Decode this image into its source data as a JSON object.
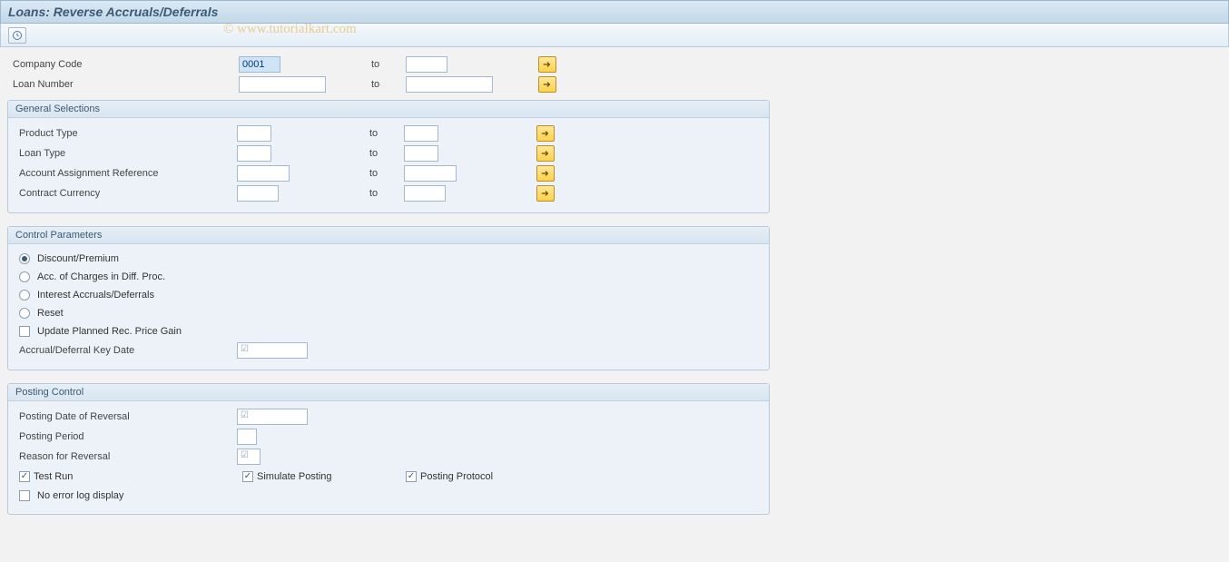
{
  "title": "Loans: Reverse Accruals/Deferrals",
  "watermark": "© www.tutorialkart.com",
  "top_fields": {
    "company_code": {
      "label": "Company Code",
      "from": "0001",
      "to_label": "to",
      "to": ""
    },
    "loan_number": {
      "label": "Loan Number",
      "from": "",
      "to_label": "to",
      "to": ""
    }
  },
  "general": {
    "legend": "General Selections",
    "product_type": {
      "label": "Product Type",
      "from": "",
      "to_label": "to",
      "to": ""
    },
    "loan_type": {
      "label": "Loan Type",
      "from": "",
      "to_label": "to",
      "to": ""
    },
    "aa_reference": {
      "label": "Account Assignment Reference",
      "from": "",
      "to_label": "to",
      "to": ""
    },
    "contract_curr": {
      "label": "Contract Currency",
      "from": "",
      "to_label": "to",
      "to": ""
    }
  },
  "control": {
    "legend": "Control Parameters",
    "r_discount": "Discount/Premium",
    "r_acc": "Acc. of Charges in Diff. Proc.",
    "r_interest": "Interest Accruals/Deferrals",
    "r_reset": "Reset",
    "cb_update": "Update Planned Rec. Price Gain",
    "keydate": {
      "label": "Accrual/Deferral Key Date",
      "value": ""
    }
  },
  "posting": {
    "legend": "Posting Control",
    "date_reversal": {
      "label": "Posting Date of Reversal",
      "value": ""
    },
    "period": {
      "label": "Posting Period",
      "value": ""
    },
    "reason": {
      "label": "Reason for Reversal",
      "value": ""
    },
    "cb_test": "Test Run",
    "cb_sim": "Simulate Posting",
    "cb_proto": "Posting Protocol",
    "cb_noerr": "No error log display"
  }
}
